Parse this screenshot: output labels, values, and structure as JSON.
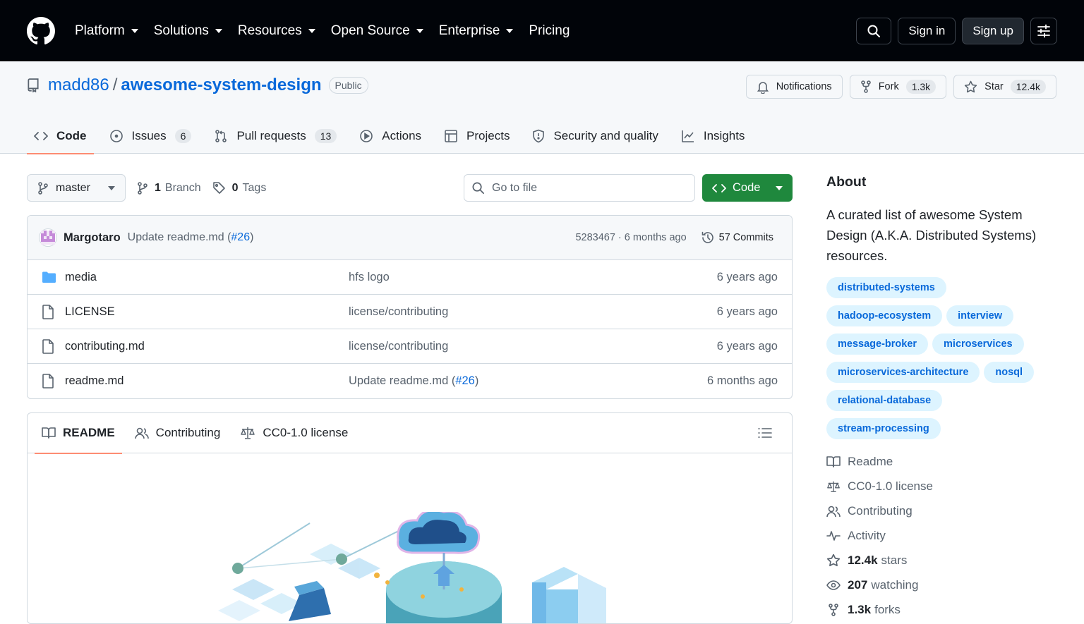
{
  "header": {
    "nav": [
      "Platform",
      "Solutions",
      "Resources",
      "Open Source",
      "Enterprise",
      "Pricing"
    ],
    "nav_has_caret": [
      true,
      true,
      true,
      true,
      true,
      false
    ],
    "sign_in": "Sign in",
    "sign_up": "Sign up"
  },
  "repo": {
    "owner": "madd86",
    "separator": "/",
    "name": "awesome-system-design",
    "visibility": "Public",
    "notifications_label": "Notifications",
    "fork_label": "Fork",
    "fork_count": "1.3k",
    "star_label": "Star",
    "star_count": "12.4k"
  },
  "tabs": [
    {
      "label": "Code",
      "count": "",
      "icon": "code-icon"
    },
    {
      "label": "Issues",
      "count": "6",
      "icon": "issue-icon"
    },
    {
      "label": "Pull requests",
      "count": "13",
      "icon": "pull-request-icon"
    },
    {
      "label": "Actions",
      "count": "",
      "icon": "play-icon"
    },
    {
      "label": "Projects",
      "count": "",
      "icon": "table-icon"
    },
    {
      "label": "Security and quality",
      "count": "",
      "icon": "shield-icon"
    },
    {
      "label": "Insights",
      "count": "",
      "icon": "graph-icon"
    }
  ],
  "toolbar": {
    "branch": "master",
    "branch_count": "1",
    "branch_label": "Branch",
    "tag_count": "0",
    "tag_label": "Tags",
    "goto_placeholder": "Go to file",
    "code_label": "Code"
  },
  "commit": {
    "author": "Margotaro",
    "message": "Update readme.md (",
    "pr": "#26",
    "message_end": ")",
    "meta": "5283467 · 6 months ago",
    "commits": "57 Commits"
  },
  "files": [
    {
      "name": "media",
      "type": "folder",
      "message": "hfs logo",
      "pr": "",
      "age": "6 years ago"
    },
    {
      "name": "LICENSE",
      "type": "file",
      "message": "license/contributing",
      "pr": "",
      "age": "6 years ago"
    },
    {
      "name": "contributing.md",
      "type": "file",
      "message": "license/contributing",
      "pr": "",
      "age": "6 years ago"
    },
    {
      "name": "readme.md",
      "type": "file",
      "message": "Update readme.md (",
      "pr": "#26",
      "age": "6 months ago"
    }
  ],
  "readme_tabs": [
    "README",
    "Contributing",
    "CC0-1.0 license"
  ],
  "about": {
    "heading": "About",
    "description": "A curated list of awesome System Design (A.K.A. Distributed Systems) resources.",
    "topics": [
      "distributed-systems",
      "hadoop-ecosystem",
      "interview",
      "message-broker",
      "microservices",
      "microservices-architecture",
      "nosql",
      "relational-database",
      "stream-processing"
    ],
    "links": {
      "readme": "Readme",
      "license": "CC0-1.0 license",
      "contributing": "Contributing",
      "activity": "Activity",
      "stars_count": "12.4k",
      "stars_label": "stars",
      "watching_count": "207",
      "watching_label": "watching",
      "forks_count": "1.3k",
      "forks_label": "forks"
    }
  },
  "colors": {
    "header_bg": "#010409",
    "link": "#0969da",
    "primary_button": "#1f883d",
    "active_tab_underline": "#fd8c73",
    "topic_bg": "#ddf4ff"
  }
}
